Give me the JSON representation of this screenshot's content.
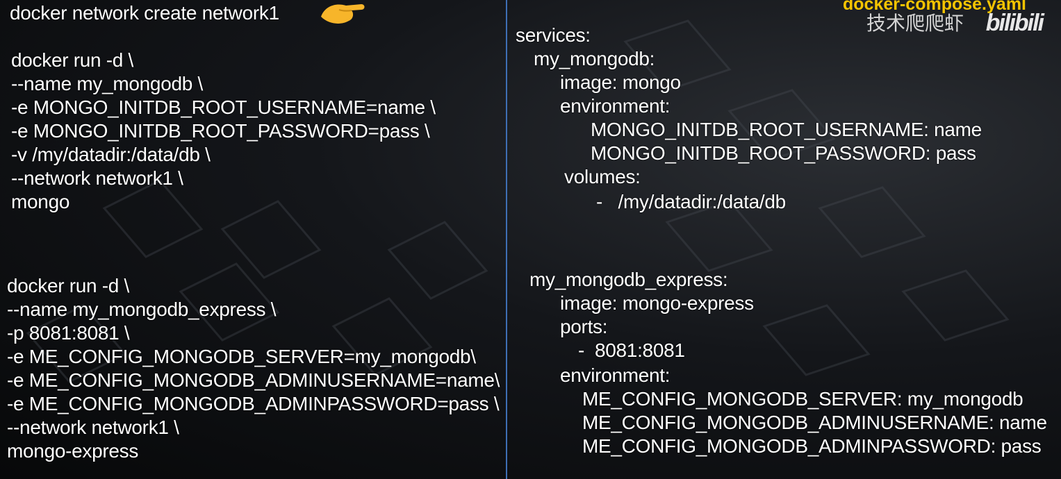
{
  "left": {
    "line_network": "docker network create network1",
    "block1": [
      "docker run -d \\",
      "--name my_mongodb \\",
      "-e MONGO_INITDB_ROOT_USERNAME=name \\",
      "-e MONGO_INITDB_ROOT_PASSWORD=pass \\",
      "-v /my/datadir:/data/db \\",
      "--network network1 \\",
      "mongo"
    ],
    "block2": [
      "docker run -d \\",
      "--name my_mongodb_express \\",
      "-p 8081:8081 \\",
      "-e ME_CONFIG_MONGODB_SERVER=my_mongodb\\",
      "-e ME_CONFIG_MONGODB_ADMINUSERNAME=name\\",
      "-e ME_CONFIG_MONGODB_ADMINPASSWORD=pass \\",
      "--network network1 \\",
      "mongo-express"
    ]
  },
  "right": {
    "block1": [
      "services:",
      "my_mongodb:",
      "image: mongo",
      "environment:",
      "MONGO_INITDB_ROOT_USERNAME: name",
      "MONGO_INITDB_ROOT_PASSWORD: pass",
      "volumes:",
      "-   /my/datadir:/data/db"
    ],
    "block2": [
      "my_mongodb_express:",
      "image: mongo-express",
      "ports:",
      "-  8081:8081",
      "environment:",
      "ME_CONFIG_MONGODB_SERVER: my_mongodb",
      "ME_CONFIG_MONGODB_ADMINUSERNAME: name",
      "ME_CONFIG_MONGODB_ADMINPASSWORD: pass"
    ]
  },
  "watermark": {
    "file_title": "docker-compose.yaml",
    "channel_name": "技术爬爬虾",
    "site_logo": "bilibili"
  },
  "icons": [
    "pointing-hand-icon"
  ],
  "colors": {
    "text": "#ffffff",
    "divider": "#3e6fb5",
    "title_accent": "#f5c400",
    "hand": "#f7b52a"
  }
}
